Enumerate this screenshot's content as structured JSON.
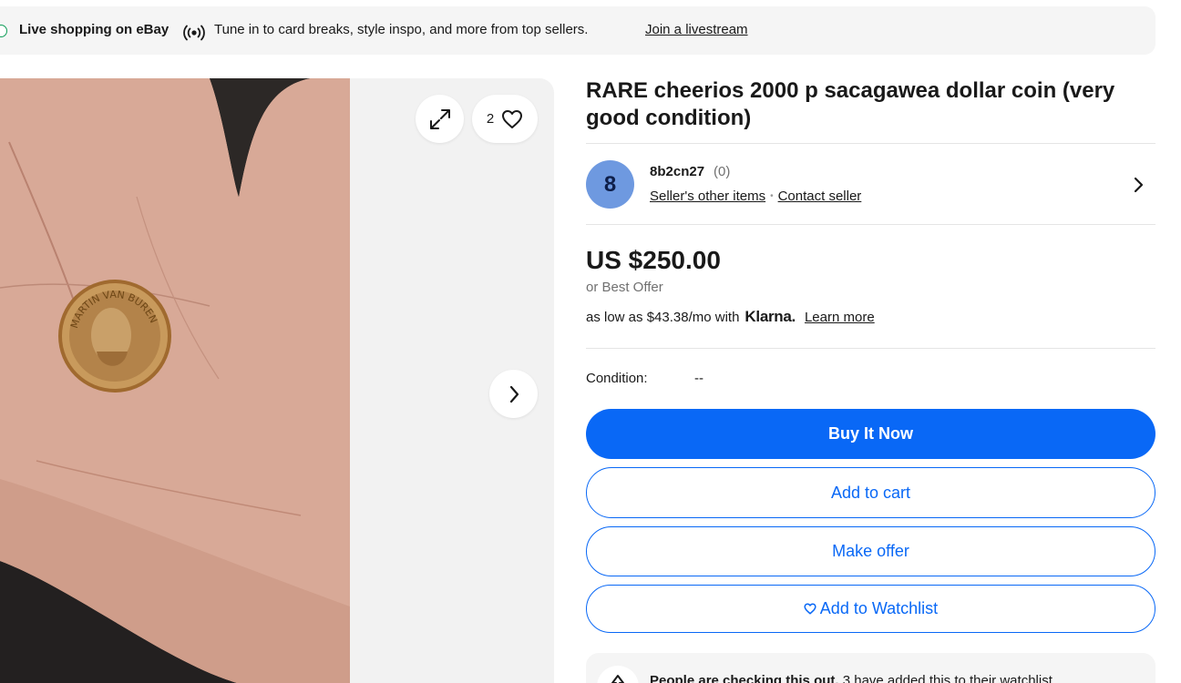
{
  "banner": {
    "title": "Live shopping on eBay",
    "text": "Tune in to card breaks, style inspo, and more from top sellers.",
    "link": "Join a livestream"
  },
  "gallery": {
    "watch_count": "2",
    "coin_text": "MARTIN VAN BUREN",
    "icons": [
      "broadcast-icon",
      "expand-icon",
      "heart-icon",
      "chevron-right-icon"
    ]
  },
  "listing": {
    "title": "RARE cheerios 2000 p sacagawea dollar coin (very good condition)",
    "price": "US $250.00",
    "best_offer": "or Best Offer",
    "klarna_prefix": "as low as $43.38/mo with",
    "klarna_logo": "Klarna.",
    "klarna_learn": "Learn more",
    "condition_label": "Condition:",
    "condition_value": "--"
  },
  "seller": {
    "initial": "8",
    "name": "8b2cn27",
    "feedback": "(0)",
    "other_items": "Seller's other items",
    "contact": "Contact seller",
    "avatar_color": "#6e99e0"
  },
  "actions": {
    "buy_now": "Buy It Now",
    "add_to_cart": "Add to cart",
    "make_offer": "Make offer",
    "add_to_watchlist": "Add to Watchlist"
  },
  "notice": {
    "bold": "People are checking this out.",
    "text": " 3 have added this to their watchlist."
  },
  "colors": {
    "accent": "#0968f6",
    "banner_bg": "#f5f5f5",
    "gallery_bg": "#f2f2f2"
  }
}
